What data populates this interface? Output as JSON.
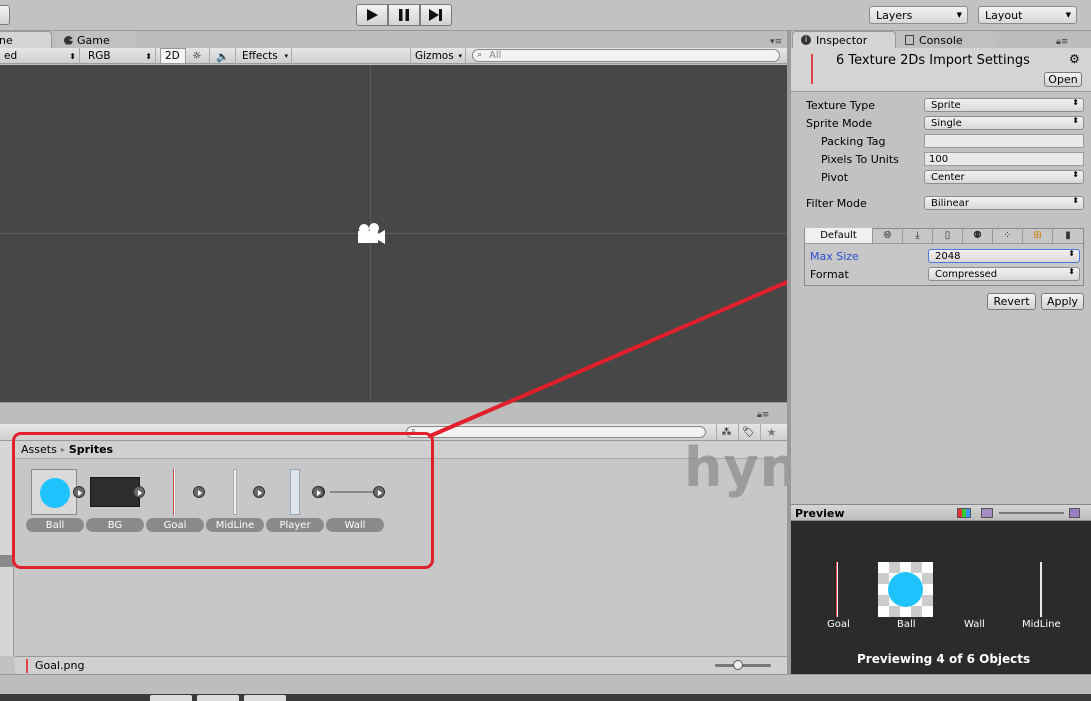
{
  "playbar": {
    "play_icon": "play-icon",
    "pause_icon": "pause-icon",
    "step_icon": "step-icon"
  },
  "top_right": {
    "layers": "Layers",
    "layout": "Layout"
  },
  "game_tabs": {
    "scene_tab_partial": "ne",
    "game_tab": "Game"
  },
  "scene_toolbar": {
    "shading_partial": "ed",
    "rgb": "RGB",
    "mode_2d": "2D",
    "effects": "Effects",
    "gizmos": "Gizmos",
    "search_placeholder": "All"
  },
  "inspector": {
    "tab_inspector": "Inspector",
    "tab_console": "Console",
    "header_title": "6 Texture 2Ds Import Settings",
    "open_button": "Open",
    "rows": {
      "texture_type_label": "Texture Type",
      "texture_type_value": "Sprite",
      "sprite_mode_label": "Sprite Mode",
      "sprite_mode_value": "Single",
      "packing_tag_label": "Packing Tag",
      "packing_tag_value": "",
      "pixels_to_units_label": "Pixels To Units",
      "pixels_to_units_value": "100",
      "pivot_label": "Pivot",
      "pivot_value": "Center",
      "filter_mode_label": "Filter Mode",
      "filter_mode_value": "Bilinear"
    },
    "platform": {
      "default_tab": "Default",
      "max_size_label": "Max Size",
      "max_size_value": "2048",
      "format_label": "Format",
      "format_value": "Compressed"
    },
    "revert_button": "Revert",
    "apply_button": "Apply"
  },
  "project": {
    "breadcrumb_root": "Assets",
    "breadcrumb_sep": "▸",
    "breadcrumb_current": "Sprites",
    "assets": [
      {
        "name": "Ball"
      },
      {
        "name": "BG"
      },
      {
        "name": "Goal"
      },
      {
        "name": "MidLine"
      },
      {
        "name": "Player"
      },
      {
        "name": "Wall"
      }
    ],
    "selected_file": "Goal.png"
  },
  "watermark": "hynra",
  "preview": {
    "title": "Preview",
    "items": [
      {
        "name": "Goal"
      },
      {
        "name": "Ball"
      },
      {
        "name": "Wall"
      },
      {
        "name": "MidLine"
      }
    ],
    "status": "Previewing 4 of 6 Objects"
  },
  "colors": {
    "highlight_red": "#e0202a",
    "scene_bg": "#474747",
    "ball_cyan": "#1ec3ff"
  }
}
